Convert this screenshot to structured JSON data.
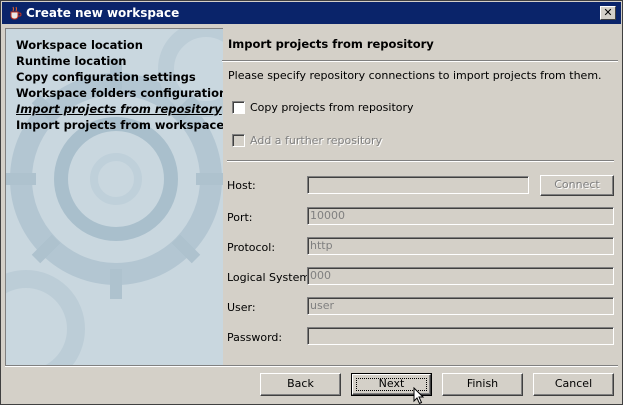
{
  "window": {
    "title": "Create new workspace"
  },
  "steps": [
    {
      "label": "Workspace location",
      "active": false
    },
    {
      "label": "Runtime location",
      "active": false
    },
    {
      "label": "Copy configuration settings",
      "active": false
    },
    {
      "label": "Workspace folders configuration",
      "active": false
    },
    {
      "label": "Import projects from repository",
      "active": true
    },
    {
      "label": "Import projects from workspaces",
      "active": false
    }
  ],
  "page": {
    "title": "Import projects from repository",
    "description": "Please specify repository connections to import projects from them.",
    "copy_checkbox_label": "Copy projects from repository",
    "add_repo_label": "Add a further repository"
  },
  "form": {
    "host_label": "Host:",
    "host_value": "",
    "connect_label": "Connect",
    "port_label": "Port:",
    "port_value": "10000",
    "protocol_label": "Protocol:",
    "protocol_value": "http",
    "logical_system_label": "Logical System:",
    "logical_system_value": "000",
    "user_label": "User:",
    "user_value": "user",
    "password_label": "Password:",
    "password_value": ""
  },
  "buttons": {
    "back": "Back",
    "next": "Next",
    "finish": "Finish",
    "cancel": "Cancel"
  },
  "icons": {
    "app": "java-cup-icon",
    "close": "close-icon",
    "cursor": "mouse-pointer-icon"
  },
  "colors": {
    "titlebar": "#0a246a",
    "dialog_bg": "#d4d0c8",
    "banner_bg": "#c9d7df",
    "disabled_text": "#808080"
  }
}
